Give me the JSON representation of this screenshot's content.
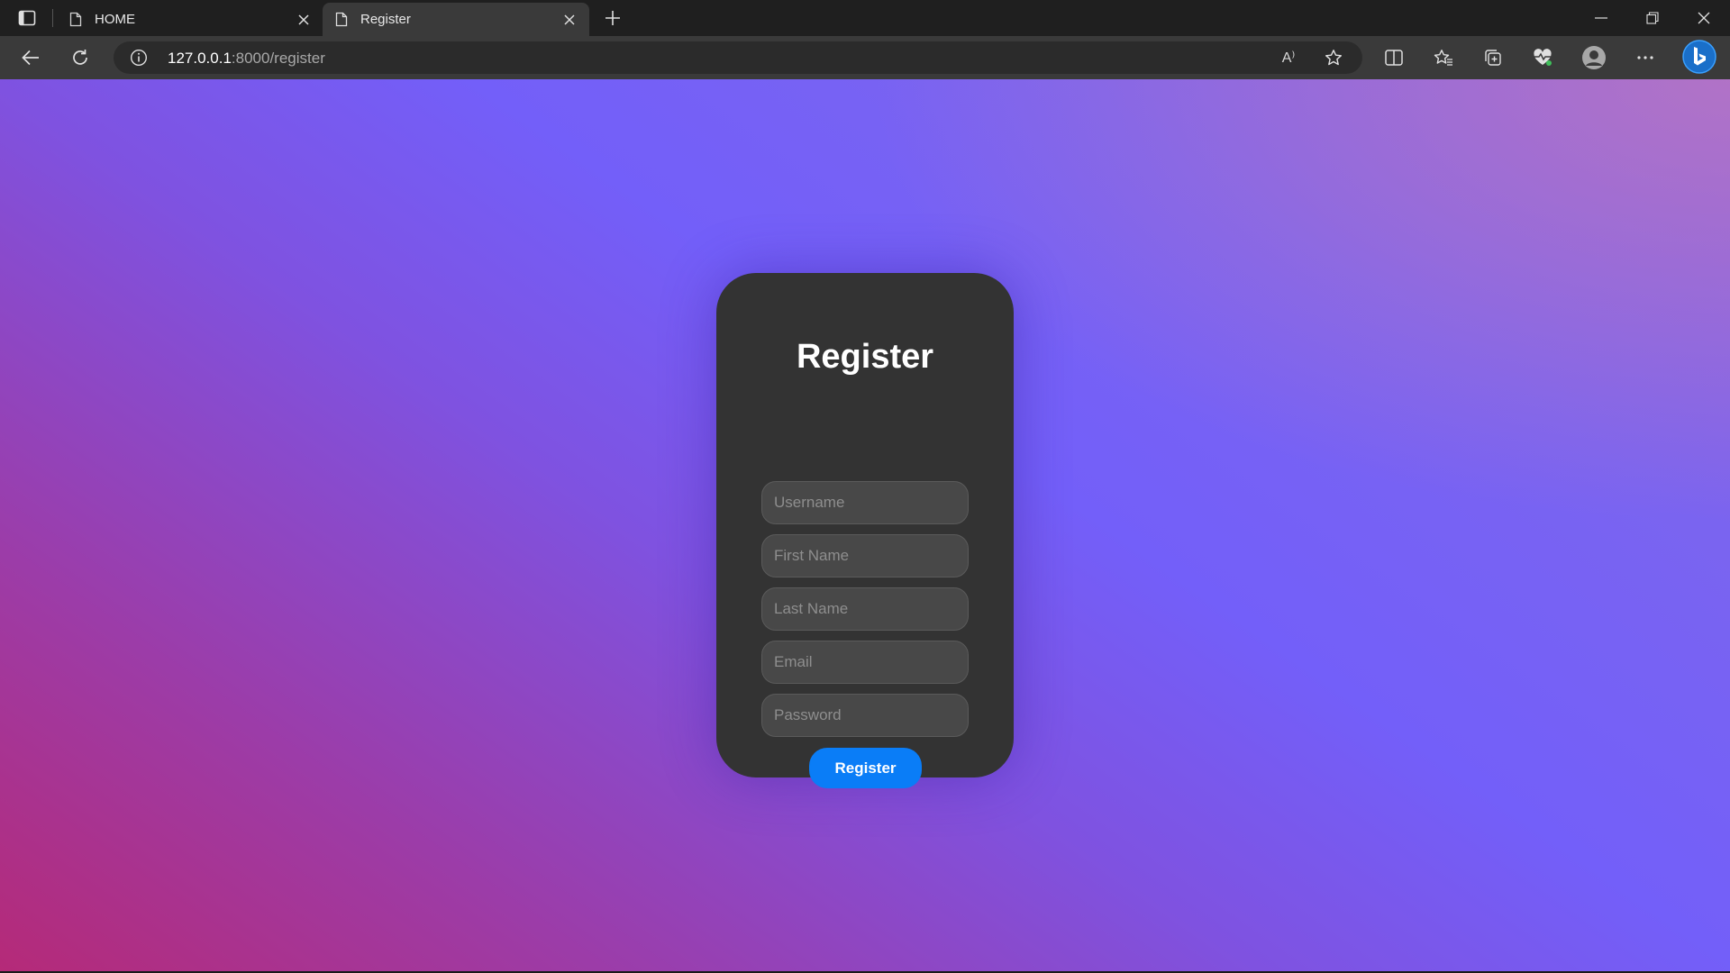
{
  "browser": {
    "tabs": [
      {
        "title": "HOME",
        "active": false
      },
      {
        "title": "Register",
        "active": true
      }
    ],
    "url_host": "127.0.0.1",
    "url_rest": ":8000/register",
    "read_aloud_label": "A⁾"
  },
  "icons": {
    "tab_actions": "tab-actions-icon",
    "page": "page-icon",
    "close": "close-icon",
    "new_tab": "plus-icon",
    "back": "back-arrow-icon",
    "refresh": "refresh-icon",
    "site_info": "info-icon",
    "favorite": "star-icon",
    "split_screen": "split-screen-icon",
    "favorites": "favorites-icon",
    "collections": "collections-icon",
    "browser_essentials": "heart-pulse-icon",
    "profile": "profile-icon",
    "menu": "more-icon",
    "copilot": "bing-icon"
  },
  "colors": {
    "accent_button": "#0a7df7",
    "card_background": "#333333",
    "gradient_start": "#b52a78",
    "gradient_mid": "#735ff9"
  },
  "form": {
    "title": "Register",
    "fields": [
      {
        "placeholder": "Username",
        "value": ""
      },
      {
        "placeholder": "First Name",
        "value": ""
      },
      {
        "placeholder": "Last Name",
        "value": ""
      },
      {
        "placeholder": "Email",
        "value": ""
      },
      {
        "placeholder": "Password",
        "value": ""
      }
    ],
    "submit_label": "Register"
  }
}
